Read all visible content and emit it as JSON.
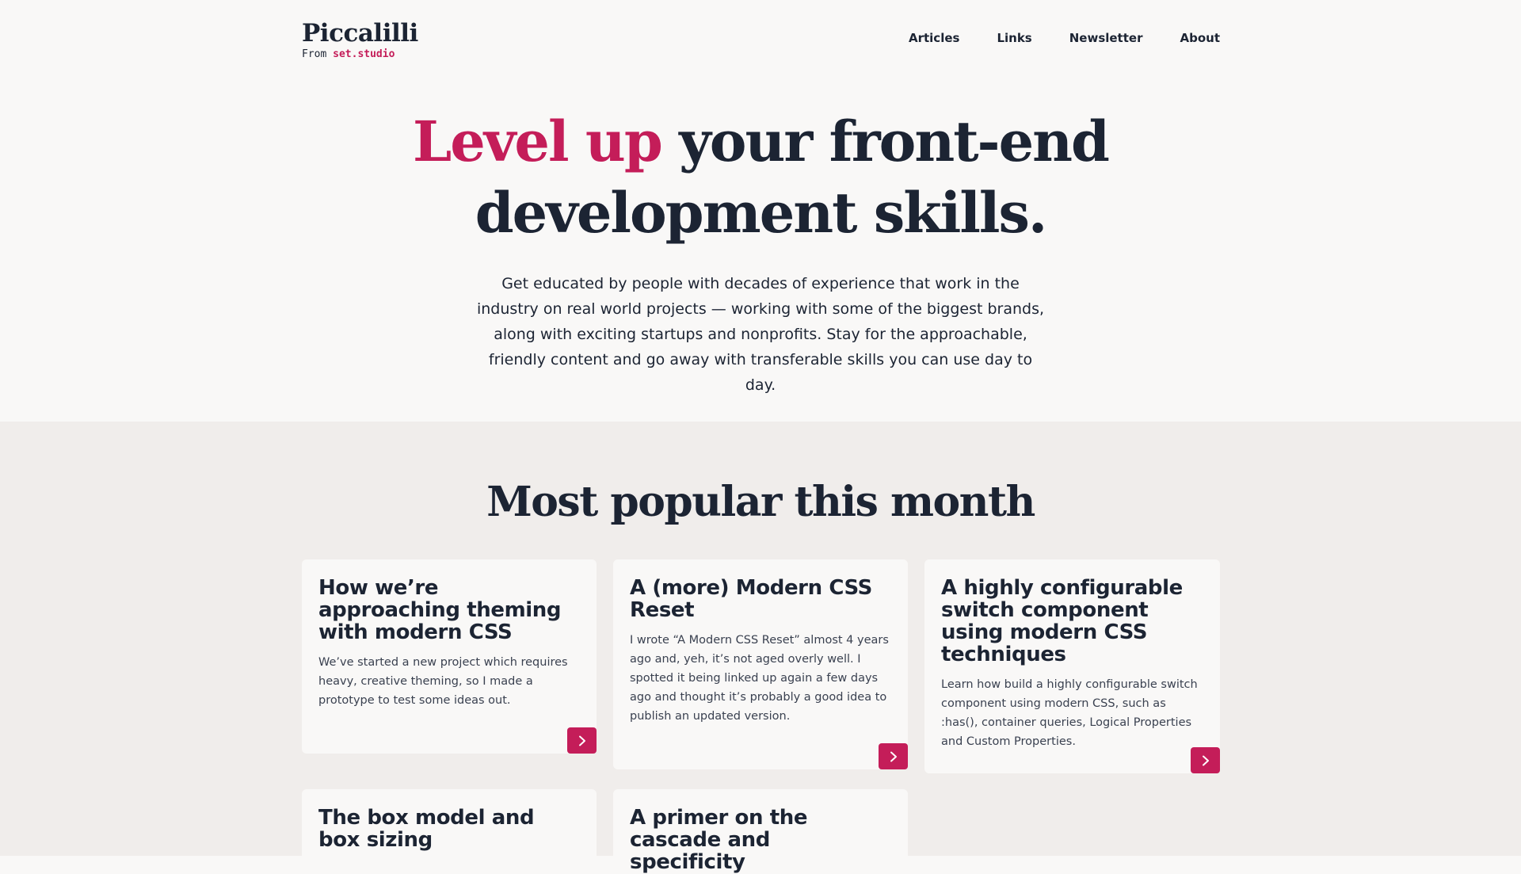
{
  "header": {
    "brand_name": "Piccalilli",
    "brand_from": "From ",
    "brand_studio": "set.studio",
    "nav": [
      "Articles",
      "Links",
      "Newsletter",
      "About"
    ]
  },
  "hero": {
    "title_accent": "Level up",
    "title_rest": " your front-end development skills.",
    "description": "Get educated by people with decades of experience that work in the industry on real world projects — working with some of the biggest brands, along with exciting startups and nonprofits. Stay for the approachable, friendly content and go away with transferable skills you can use day to day."
  },
  "popular": {
    "title": "Most popular this month",
    "cards": [
      {
        "title": "How we’re approaching theming with modern CSS",
        "text": "We’ve started a new project which requires heavy, creative theming, so I made a prototype to test some ideas out."
      },
      {
        "title": "A (more) Modern CSS Reset",
        "text": "I wrote “A Modern CSS Reset” almost 4 years ago and, yeh, it’s not aged overly well. I spotted it being linked up again a few days ago and thought it’s probably a good idea to publish an updated version."
      },
      {
        "title": "A highly configurable switch component using modern CSS techniques",
        "text": "Learn how build a highly configurable switch component using modern CSS, such as :has(), container queries, Logical Properties and Custom Properties."
      },
      {
        "title": "The box model and box sizing",
        "text": ""
      },
      {
        "title": "A primer on the cascade and specificity",
        "text": ""
      }
    ]
  },
  "colors": {
    "accent": "#c41d59",
    "text": "#1c2433",
    "page_bg": "#f9f8f7",
    "section_bg": "#f0edeb"
  },
  "icons": {
    "card_button": "chevron-right-icon"
  }
}
